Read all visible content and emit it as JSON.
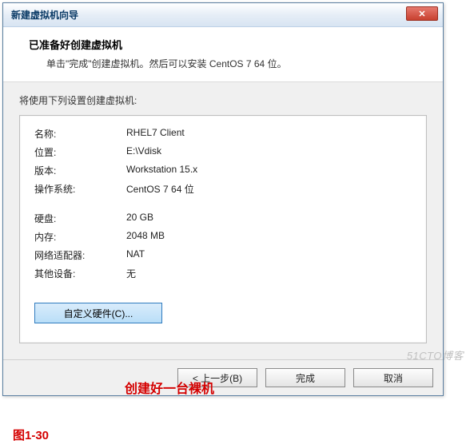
{
  "window": {
    "title": "新建虚拟机向导",
    "close_symbol": "✕"
  },
  "header": {
    "title": "已准备好创建虚拟机",
    "subtitle": "单击\"完成\"创建虚拟机。然后可以安装 CentOS 7 64 位。"
  },
  "body": {
    "intro": "将使用下列设置创建虚拟机:",
    "group1": [
      {
        "label": "名称:",
        "value": "RHEL7 Client"
      },
      {
        "label": "位置:",
        "value": "E:\\Vdisk"
      },
      {
        "label": "版本:",
        "value": "Workstation 15.x"
      },
      {
        "label": "操作系统:",
        "value": "CentOS 7 64 位"
      }
    ],
    "group2": [
      {
        "label": "硬盘:",
        "value": "20 GB"
      },
      {
        "label": "内存:",
        "value": "2048 MB"
      },
      {
        "label": "网络适配器:",
        "value": "NAT"
      },
      {
        "label": "其他设备:",
        "value": "无"
      }
    ],
    "customize_btn": "自定义硬件(C)..."
  },
  "buttons": {
    "back": "< 上一步(B)",
    "finish": "完成",
    "cancel": "取消"
  },
  "annotation": {
    "text": "创建好一台裸机",
    "figure": "图1-30"
  },
  "watermark": "51CTO博客"
}
